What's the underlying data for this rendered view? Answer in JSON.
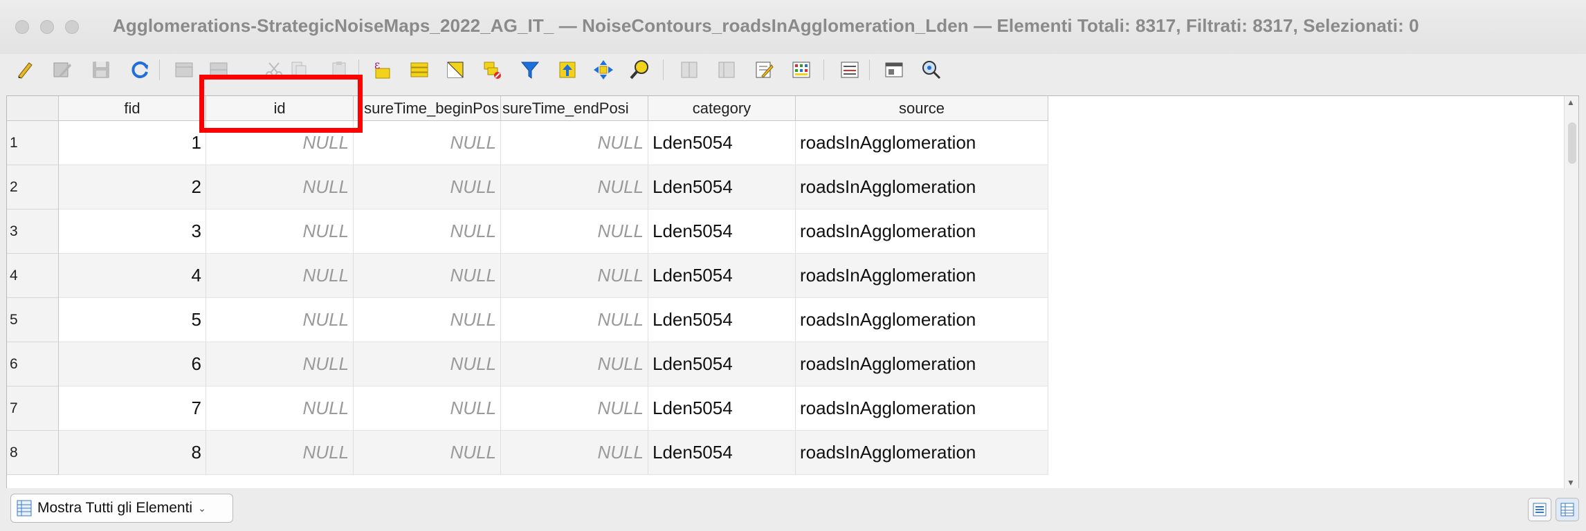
{
  "window": {
    "title": "Agglomerations-StrategicNoiseMaps_2022_AG_IT_ — NoiseContours_roadsInAgglomeration_Lden — Elementi Totali: 8317, Filtrati: 8317, Selezionati: 0"
  },
  "toolbar": {
    "icons": [
      "edit-pencil-icon",
      "multi-edit-icon",
      "save-edits-icon",
      "reload-icon",
      "add-feature-icon",
      "delete-feature-icon",
      "cut-icon",
      "copy-icon",
      "paste-icon",
      "expression-select-icon",
      "select-all-icon",
      "invert-selection-icon",
      "deselect-all-icon",
      "filter-icon",
      "move-selection-top-icon",
      "pan-to-selection-icon",
      "zoom-to-selection-icon",
      "new-field-icon",
      "delete-field-icon",
      "open-field-calculator-icon",
      "conditional-formatting-icon",
      "actions-icon",
      "dock-table-icon",
      "organize-columns-icon"
    ]
  },
  "table": {
    "columns": [
      "fid",
      "id",
      "sureTime_beginPos",
      "sureTime_endPosi",
      "category",
      "source"
    ],
    "rows": [
      {
        "rownum": "1",
        "fid": "1",
        "id": "NULL",
        "begin": "NULL",
        "end": "NULL",
        "category": "Lden5054",
        "source": "roadsInAgglomeration"
      },
      {
        "rownum": "2",
        "fid": "2",
        "id": "NULL",
        "begin": "NULL",
        "end": "NULL",
        "category": "Lden5054",
        "source": "roadsInAgglomeration"
      },
      {
        "rownum": "3",
        "fid": "3",
        "id": "NULL",
        "begin": "NULL",
        "end": "NULL",
        "category": "Lden5054",
        "source": "roadsInAgglomeration"
      },
      {
        "rownum": "4",
        "fid": "4",
        "id": "NULL",
        "begin": "NULL",
        "end": "NULL",
        "category": "Lden5054",
        "source": "roadsInAgglomeration"
      },
      {
        "rownum": "5",
        "fid": "5",
        "id": "NULL",
        "begin": "NULL",
        "end": "NULL",
        "category": "Lden5054",
        "source": "roadsInAgglomeration"
      },
      {
        "rownum": "6",
        "fid": "6",
        "id": "NULL",
        "begin": "NULL",
        "end": "NULL",
        "category": "Lden5054",
        "source": "roadsInAgglomeration"
      },
      {
        "rownum": "7",
        "fid": "7",
        "id": "NULL",
        "begin": "NULL",
        "end": "NULL",
        "category": "Lden5054",
        "source": "roadsInAgglomeration"
      },
      {
        "rownum": "8",
        "fid": "8",
        "id": "NULL",
        "begin": "NULL",
        "end": "NULL",
        "category": "Lden5054",
        "source": "roadsInAgglomeration"
      }
    ]
  },
  "bottom": {
    "filter_button_label": "Mostra Tutti gli Elementi"
  },
  "colors": {
    "highlight": "#ff0000",
    "alt_row": "#f4f4f4"
  }
}
